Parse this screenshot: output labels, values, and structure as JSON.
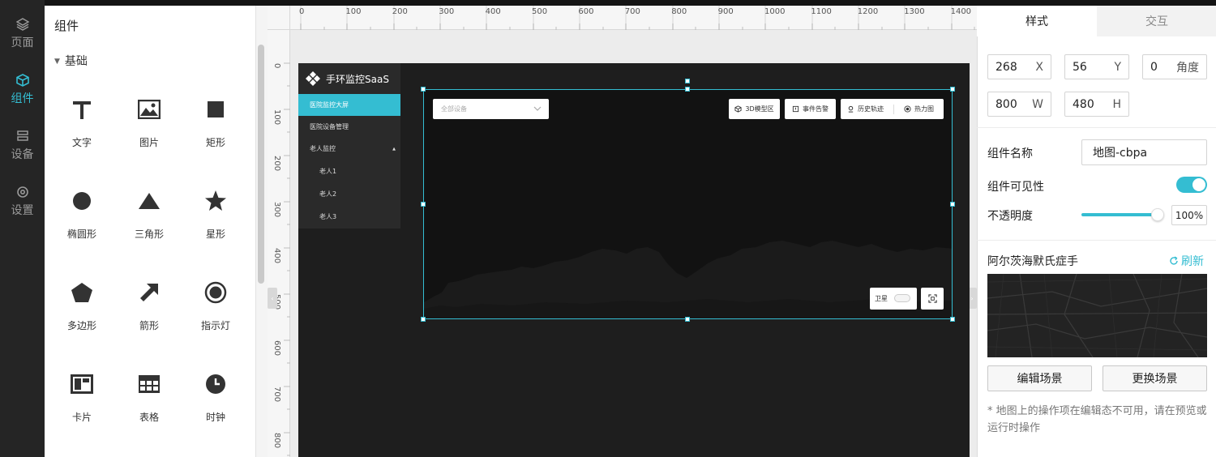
{
  "nav": {
    "items": [
      {
        "label": "页面",
        "icon": "layers-icon"
      },
      {
        "label": "组件",
        "icon": "cube-icon"
      },
      {
        "label": "设备",
        "icon": "device-icon"
      },
      {
        "label": "设置",
        "icon": "gear-icon"
      }
    ],
    "active_index": 1
  },
  "components_panel": {
    "title": "组件",
    "section": "基础",
    "items": [
      {
        "label": "文字",
        "icon": "text-icon"
      },
      {
        "label": "图片",
        "icon": "image-icon"
      },
      {
        "label": "矩形",
        "icon": "rectangle-icon"
      },
      {
        "label": "椭圆形",
        "icon": "ellipse-icon"
      },
      {
        "label": "三角形",
        "icon": "triangle-icon"
      },
      {
        "label": "星形",
        "icon": "star-icon"
      },
      {
        "label": "多边形",
        "icon": "polygon-icon"
      },
      {
        "label": "箭形",
        "icon": "arrow-icon"
      },
      {
        "label": "指示灯",
        "icon": "indicator-icon"
      },
      {
        "label": "卡片",
        "icon": "card-icon"
      },
      {
        "label": "表格",
        "icon": "table-icon"
      },
      {
        "label": "时钟",
        "icon": "clock-icon"
      }
    ]
  },
  "ruler": {
    "top": [
      "0",
      "100",
      "200",
      "300",
      "400",
      "500",
      "600",
      "700",
      "800",
      "900",
      "1000",
      "1100",
      "1200",
      "1300",
      "1400"
    ],
    "left": [
      "0",
      "100",
      "200",
      "300",
      "400",
      "500",
      "600",
      "700",
      "800"
    ]
  },
  "app": {
    "brand": "手环监控SaaS",
    "menu": [
      "医院监控大屏",
      "医院设备管理",
      "老人监控",
      "老人1",
      "老人2",
      "老人3"
    ],
    "menu_active_index": 0,
    "collapse_marker": "▲"
  },
  "map": {
    "select_placeholder": "全部设备",
    "buttons": [
      "3D模型区",
      "事件告警",
      "历史轨迹",
      "热力图"
    ],
    "satellite_label": "卫星"
  },
  "props": {
    "tabs": [
      "样式",
      "交互"
    ],
    "x": {
      "value": "268",
      "suffix": "X"
    },
    "y": {
      "value": "56",
      "suffix": "Y"
    },
    "angle": {
      "value": "0",
      "suffix": "角度"
    },
    "w": {
      "value": "800",
      "suffix": "W"
    },
    "h": {
      "value": "480",
      "suffix": "H"
    },
    "name_label": "组件名称",
    "name_value": "地图-cbpa",
    "visibility_label": "组件可见性",
    "visibility_on": true,
    "opacity_label": "不透明度",
    "opacity_value": "100%",
    "scene_title": "阿尔茨海默氏症手",
    "refresh_label": "刷新",
    "edit_scene": "编辑场景",
    "replace_scene": "更换场景",
    "note": "* 地图上的操作项在编辑态不可用，请在预览或运行时操作"
  },
  "colors": {
    "accent": "#34bdd2",
    "nav_bg": "#252525",
    "stage_bg": "#1e1e1e"
  }
}
